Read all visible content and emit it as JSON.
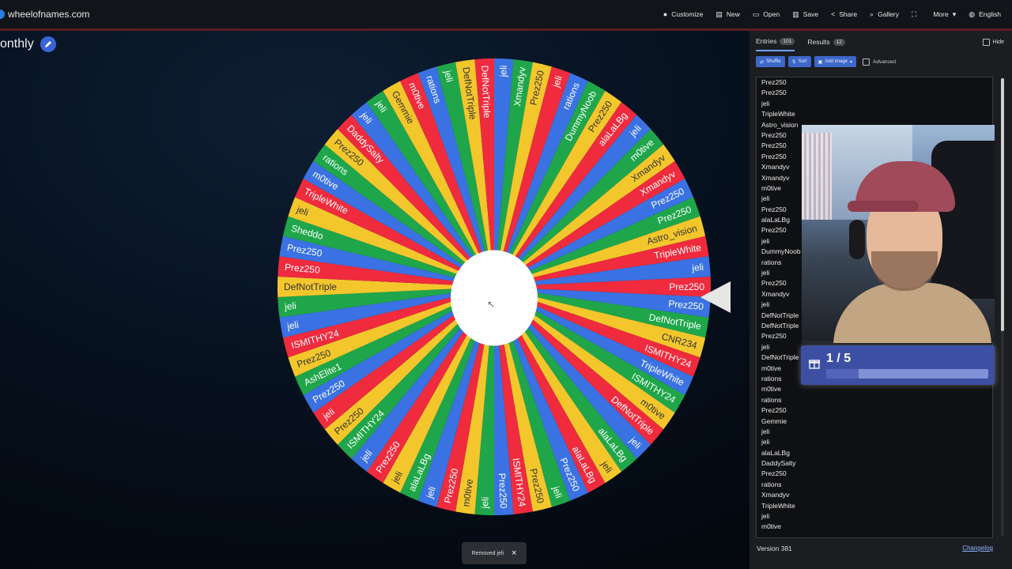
{
  "site": {
    "domain": "wheelofnames.com"
  },
  "menu": [
    {
      "label": "Customize",
      "icon": "palette-icon"
    },
    {
      "label": "New",
      "icon": "file-icon"
    },
    {
      "label": "Open",
      "icon": "folder-icon"
    },
    {
      "label": "Save",
      "icon": "save-icon"
    },
    {
      "label": "Share",
      "icon": "share-icon"
    },
    {
      "label": "Gallery",
      "icon": "search-icon"
    },
    {
      "label": "",
      "icon": "fullscreen-icon"
    },
    {
      "label": "More",
      "icon": "chevron-down-icon"
    },
    {
      "label": "English",
      "icon": "globe-icon"
    }
  ],
  "wheel": {
    "title": "onthly",
    "colors": [
      "#ef2b3d",
      "#3a72e3",
      "#1fa64a",
      "#f3c72c"
    ],
    "segments": [
      "Prez250",
      "Prez250",
      "DefNotTriple",
      "CNR234",
      "ISMITHY24",
      "TripleWhite",
      "ISMITHY24",
      "m0tive",
      "DefNotTriple",
      "jeli",
      "alaLaLBg",
      "jeli",
      "alaLaLBg",
      "Prez250",
      "jeli",
      "Prez250",
      "ISMITHY24",
      "Prez250",
      "jeli",
      "m0tive",
      "Prez250",
      "jeli",
      "alaLaLBg",
      "jeli",
      "Prez250",
      "jeli",
      "ISMITHY24",
      "Prez250",
      "jeli",
      "Prez250",
      "AshElite1",
      "Prez250",
      "ISMITHY24",
      "jeli",
      "jeli",
      "DefNotTriple",
      "Prez250",
      "Prez250",
      "Sheddo",
      "jeli",
      "TripleWhite",
      "m0tive",
      "rations",
      "Prez250",
      "DaddySalty",
      "jeli",
      "jeli",
      "Gemmie",
      "m0tive",
      "rations",
      "jeli",
      "DefNotTriple",
      "DefNotTriple",
      "jeli",
      "Xmandyv",
      "Prez250",
      "jeli",
      "rations",
      "DummyNoob",
      "Prez250",
      "alaLaLBg",
      "jeli",
      "m0tive",
      "Xmandyv",
      "Xmandyv",
      "Prez250",
      "Prez250",
      "Astro_vision",
      "TripleWhite",
      "jeli"
    ]
  },
  "toast": {
    "text": "Removed jeli",
    "close": "×"
  },
  "panel": {
    "tabs": [
      {
        "label": "Entries",
        "badge": "101"
      },
      {
        "label": "Results",
        "badge": "12"
      }
    ],
    "hide_label": "Hide",
    "toolbar": {
      "shuffle": "Shuffle",
      "sort": "Sort",
      "add_image": "Add image",
      "advanced": "Advanced"
    },
    "entries": [
      "Prez250",
      "Prez250",
      "jeli",
      "TripleWhite",
      "Astro_vision",
      "Prez250",
      "Prez250",
      "Prez250",
      "Xmandyv",
      "Xmandyv",
      "m0tive",
      "jeli",
      "Prez250",
      "alaLaLBg",
      "Prez250",
      "jeli",
      "DummyNoob",
      "rations",
      "jeli",
      "Prez250",
      "Xmandyv",
      "jeli",
      "DefNotTriple",
      "DefNotTriple",
      "Prez250",
      "jeli",
      "DefNotTriple",
      "m0tive",
      "rations",
      "m0tive",
      "rations",
      "Prez250",
      "Gemmie",
      "jeli",
      "jeli",
      "alaLaLBg",
      "DaddySalty",
      "Prez250",
      "rations",
      "Xmandyv",
      "TripleWhite",
      "jeli",
      "m0tive"
    ],
    "version": "Version 381",
    "changelog": "Changelog"
  },
  "overlay": {
    "progress_text": "1 / 5",
    "progress_fraction": 0.2
  }
}
